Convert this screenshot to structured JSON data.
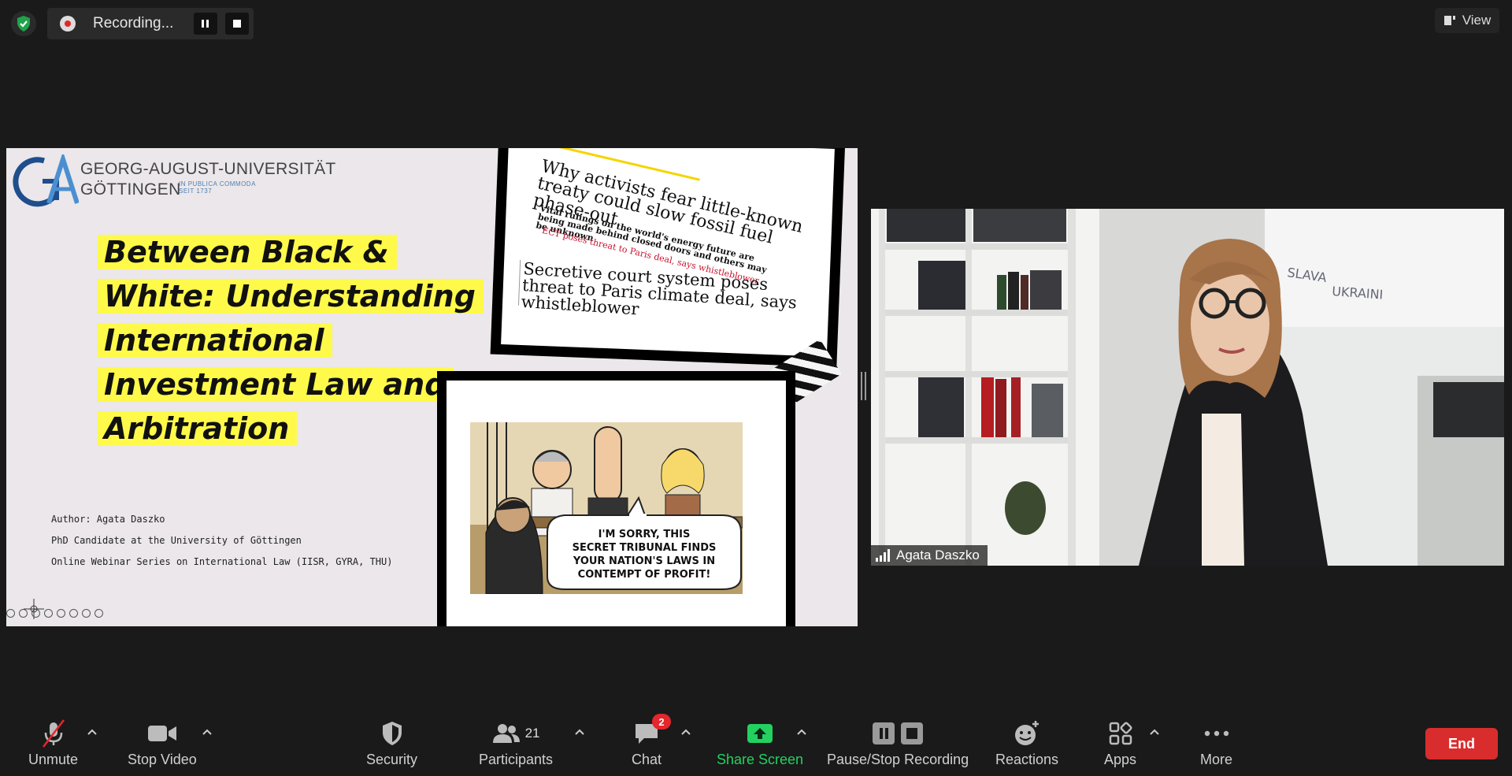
{
  "recording": {
    "status_label": "Recording..."
  },
  "view": {
    "label": "View"
  },
  "slide": {
    "university_line1": "GEORG-AUGUST-UNIVERSITÄT",
    "university_line2": "GÖTTINGEN",
    "motto_line1": "IN PUBLICA COMMODA",
    "motto_line2": "SEIT 1737",
    "title_lines": [
      "Between Black &",
      "White: Understanding",
      "International",
      "Investment Law and",
      "Arbitration"
    ],
    "author_lines": [
      "Author: Agata Daszko",
      "PhD Candidate at the University of Göttingen",
      "Online Webinar Series on International Law (IISR, GYRA, THU)"
    ],
    "newspaper": {
      "headline": "Why activists fear little-known treaty could slow fossil fuel phase-out",
      "subhead": "Vital rulings on the world's energy future are being made behind closed doors and others may be unknown",
      "related_link": "ECT poses threat to Paris deal, says whistleblower",
      "headline2": "Secretive court system poses threat to Paris climate deal, says whistleblower"
    },
    "cartoon_caption": [
      "I'M SORRY, THIS",
      "SECRET TRIBUNAL FINDS",
      "YOUR NATION'S LAWS IN",
      "CONTEMPT OF PROFIT!"
    ]
  },
  "participant": {
    "name": "Agata Daszko"
  },
  "whiteboard": {
    "word1": "SLAVA",
    "word2": "UKRAINI"
  },
  "toolbar": {
    "unmute": "Unmute",
    "stop_video": "Stop Video",
    "security": "Security",
    "participants": "Participants",
    "participants_count": "21",
    "chat": "Chat",
    "chat_badge": "2",
    "share_screen": "Share Screen",
    "pause_stop_recording": "Pause/Stop Recording",
    "reactions": "Reactions",
    "apps": "Apps",
    "more": "More",
    "end": "End"
  },
  "colors": {
    "share_green": "#23d160",
    "end_red": "#d92d2d",
    "highlight_yellow": "#fff94a",
    "badge_red": "#e5262d"
  }
}
